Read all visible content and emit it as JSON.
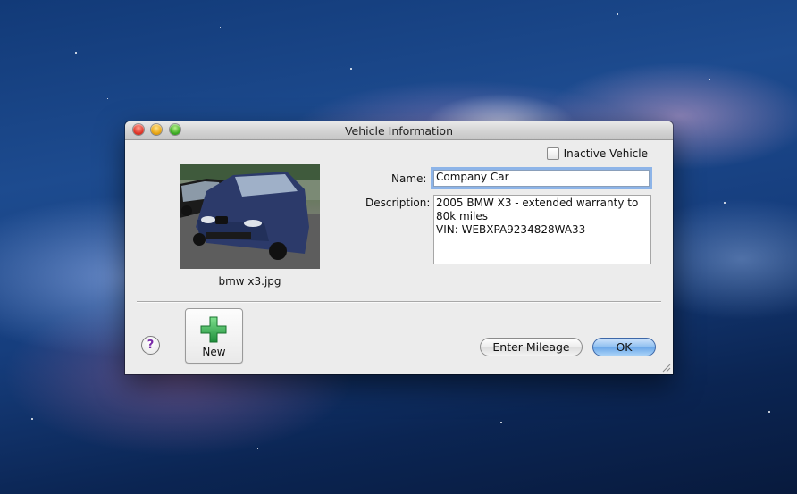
{
  "window": {
    "title": "Vehicle Information"
  },
  "form": {
    "inactive_label": "Inactive Vehicle",
    "inactive_checked": false,
    "name_label": "Name:",
    "name_value": "Company Car",
    "description_label": "Description:",
    "description_value": "2005 BMW X3 - extended warranty to\n80k miles\nVIN: WEBXPA9234828WA33"
  },
  "photo": {
    "caption": "bmw x3.jpg"
  },
  "buttons": {
    "help": "?",
    "new_label": "New",
    "enter_mileage": "Enter Mileage",
    "ok": "OK"
  },
  "colors": {
    "focus_ring": "#8db4e8",
    "ok_button": "#6aa6e8",
    "new_plus": "#2fae4a"
  },
  "icons": {
    "help": "question-mark-icon",
    "new": "green-plus-icon"
  }
}
